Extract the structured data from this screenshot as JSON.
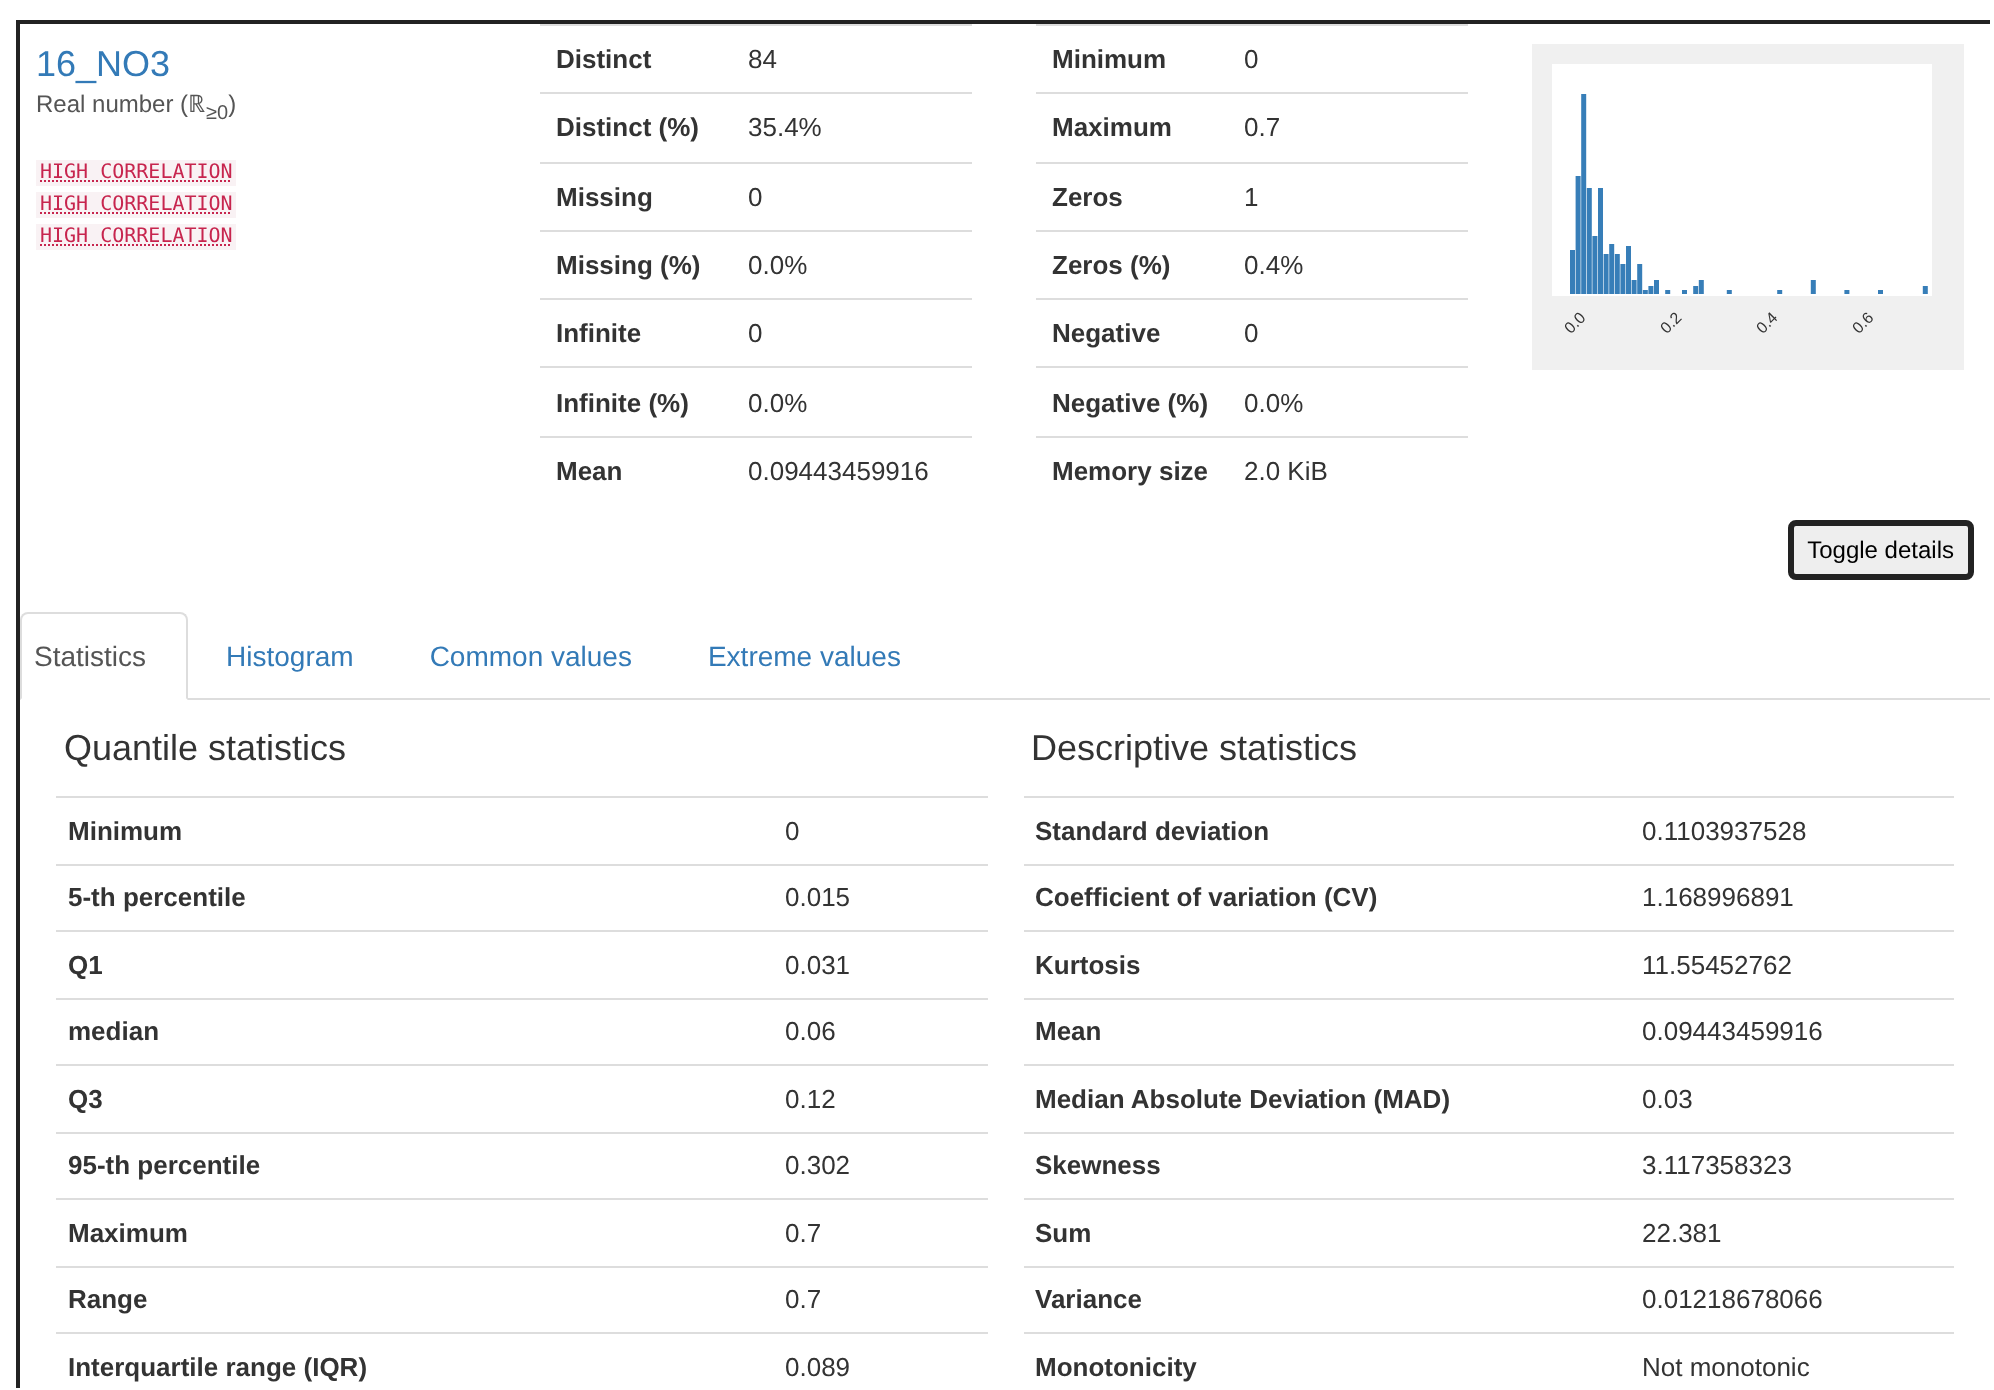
{
  "variable": {
    "name": "16_NO3",
    "type": "Real number (ℝ$_{≥0}$)"
  },
  "alerts": [
    "HIGH CORRELATION",
    "HIGH CORRELATION",
    "HIGH CORRELATION"
  ],
  "table_1": [
    [
      "Distinct",
      "84"
    ],
    [
      "Distinct (%)",
      "35.4%"
    ],
    [
      "Missing",
      "0"
    ],
    [
      "Missing (%)",
      "0.0%"
    ],
    [
      "Infinite",
      "0"
    ],
    [
      "Infinite (%)",
      "0.0%"
    ],
    [
      "Mean",
      "0.09443459916"
    ]
  ],
  "table_2": [
    [
      "Minimum",
      "0"
    ],
    [
      "Maximum",
      "0.7"
    ],
    [
      "Zeros",
      "1"
    ],
    [
      "Zeros (%)",
      "0.4%"
    ],
    [
      "Negative",
      "0"
    ],
    [
      "Negative (%)",
      "0.0%"
    ],
    [
      "Memory size",
      "2.0 KiB"
    ]
  ],
  "mini_histogram": {
    "x_tick_labels": [
      "0.0",
      "0.2",
      "0.4",
      "0.6"
    ]
  },
  "toggle_button": "Toggle details",
  "tabs": [
    {
      "label": "Statistics",
      "selected": true
    },
    {
      "label": "Histogram",
      "selected": false
    },
    {
      "label": "Common values",
      "selected": false
    },
    {
      "label": "Extreme values",
      "selected": false
    }
  ],
  "quantile": {
    "title": "Quantile statistics",
    "rows": [
      [
        "Minimum",
        "0"
      ],
      [
        "5-th percentile",
        "0.015"
      ],
      [
        "Q1",
        "0.031"
      ],
      [
        "median",
        "0.06"
      ],
      [
        "Q3",
        "0.12"
      ],
      [
        "95-th percentile",
        "0.302"
      ],
      [
        "Maximum",
        "0.7"
      ],
      [
        "Range",
        "0.7"
      ],
      [
        "Interquartile range (IQR)",
        "0.089"
      ]
    ]
  },
  "descriptive": {
    "title": "Descriptive statistics",
    "rows": [
      [
        "Standard deviation",
        "0.1103937528"
      ],
      [
        "Coefficient of variation (CV)",
        "1.168996891"
      ],
      [
        "Kurtosis",
        "11.55452762"
      ],
      [
        "Mean",
        "0.09443459916"
      ],
      [
        "Median Absolute Deviation (MAD)",
        "0.03"
      ],
      [
        "Skewness",
        "3.117358323"
      ],
      [
        "Sum",
        "22.381"
      ],
      [
        "Variance",
        "0.01218678066"
      ],
      [
        "Monotonicity",
        "Not monotonic"
      ]
    ]
  }
}
